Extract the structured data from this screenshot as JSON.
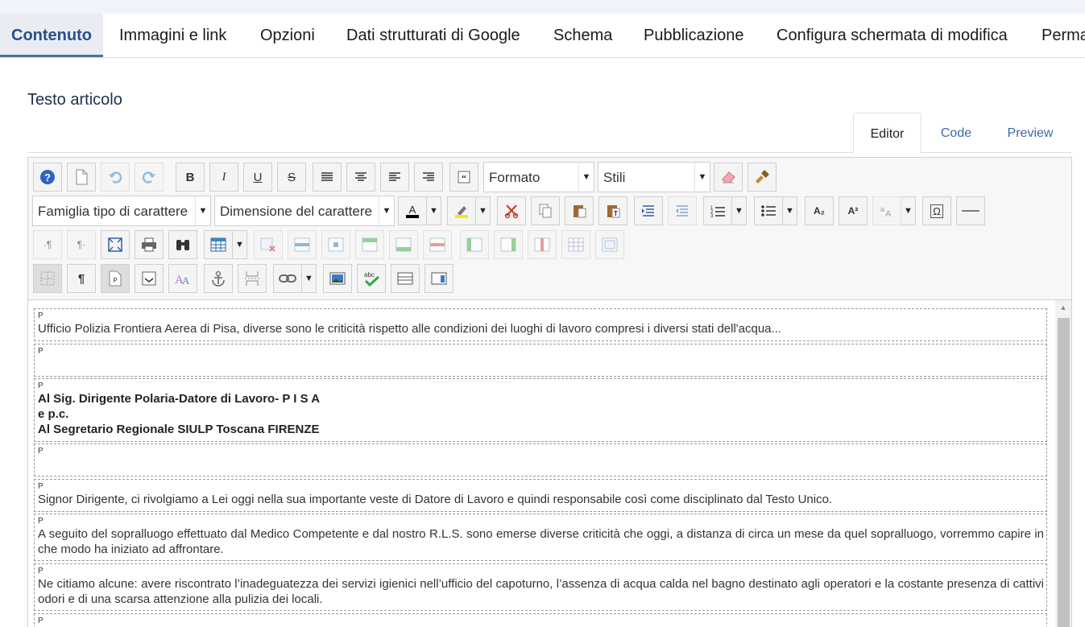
{
  "tabs": [
    "Contenuto",
    "Immagini e link",
    "Opzioni",
    "Dati strutturati di Google",
    "Schema",
    "Pubblicazione",
    "Configura schermata di modifica",
    "Perma"
  ],
  "section_title": "Testo articolo",
  "view_tabs": [
    "Editor",
    "Code",
    "Preview"
  ],
  "toolbar": {
    "format_label": "Formato",
    "styles_label": "Stili",
    "font_family_label": "Famiglia tipo di carattere",
    "font_size_label": "Dimensione del carattere",
    "bold": "B",
    "italic": "I",
    "underline": "U",
    "strike": "S",
    "subscript": "A₂",
    "superscript": "A²",
    "omega": "Ω",
    "pilcrow": "¶"
  },
  "content": {
    "p_tag": "P",
    "p1": "Ufficio Polizia Frontiera Aerea di Pisa, diverse sono le criticità rispetto alle condizioni dei luoghi di lavoro compresi i diversi stati dell'acqua...",
    "p3_line1": "Al Sig. Dirigente Polaria-Datore di Lavoro- P I S A",
    "p3_line2": "e p.c.",
    "p3_line3": "Al Segretario Regionale SIULP Toscana FIRENZE",
    "p5": "Signor Dirigente, ci rivolgiamo a Lei oggi nella sua importante veste di Datore di Lavoro e quindi responsabile così come disciplinato dal Testo Unico.",
    "p6": "A seguito del sopralluogo effettuato dal Medico Competente e dal nostro R.L.S. sono emerse diverse criticità che oggi, a distanza di circa un mese da quel sopralluogo, vorremmo capire in che modo ha iniziato ad affrontare.",
    "p7": "Ne citiamo alcune: avere riscontrato l’inadeguatezza dei servizi igienici nell’ufficio del capoturno, l’assenza di acqua calda nel bagno destinato agli operatori e la costante presenza di cattivi odori e di una scarsa attenzione alla pulizia dei locali."
  },
  "colors": {
    "accent": "#2a4e8a",
    "link": "#3b6aa8",
    "active_tab_bg": "#e9edf3"
  }
}
